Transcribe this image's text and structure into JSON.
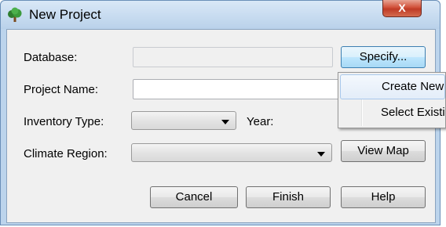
{
  "window": {
    "title": "New Project",
    "close_glyph": "X",
    "icon": "tree-icon"
  },
  "form": {
    "database_label": "Database:",
    "database_value": "",
    "project_name_label": "Project Name:",
    "project_name_value": "",
    "inventory_type_label": "Inventory Type:",
    "inventory_type_value": "",
    "year_label": "Year:",
    "climate_region_label": "Climate Region:",
    "climate_region_value": ""
  },
  "buttons": {
    "specify": "Specify...",
    "view_map": "View Map",
    "cancel": "Cancel",
    "finish": "Finish",
    "help": "Help"
  },
  "menu": {
    "items": [
      {
        "label": "Create New"
      },
      {
        "label": "Select Existing"
      }
    ]
  },
  "colors": {
    "title_bar": "#b9d1ea",
    "close_button": "#d1513a",
    "dialog_background": "#f0f0f0"
  }
}
